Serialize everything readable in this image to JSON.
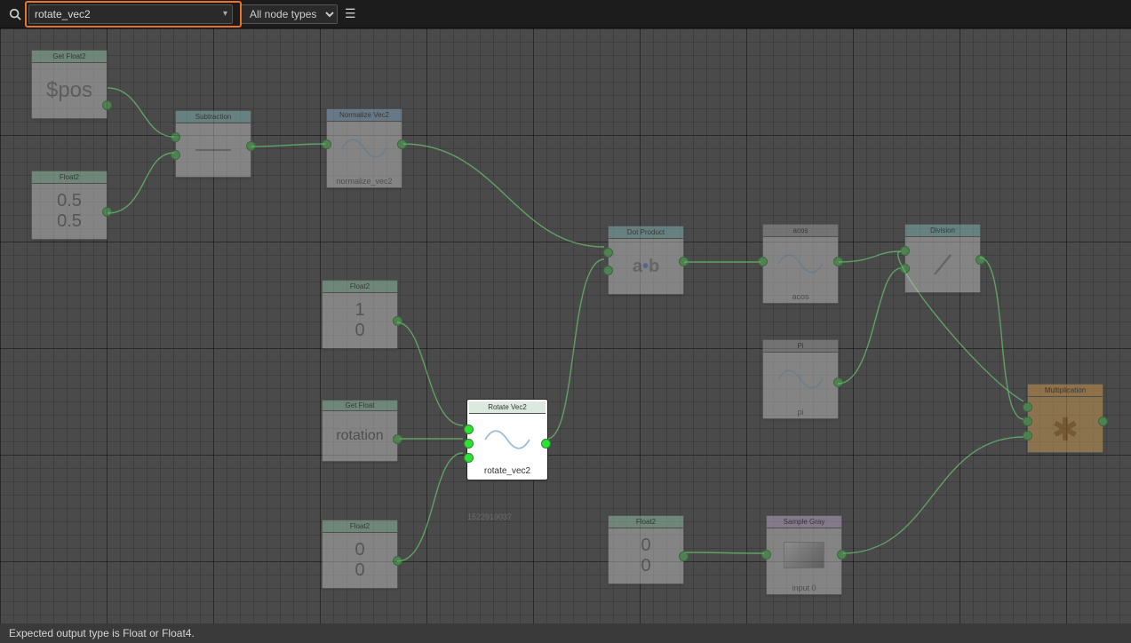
{
  "toolbar": {
    "search_value": "rotate_vec2",
    "filter_label": "All node types"
  },
  "status_text": "Expected output type is Float or Float4.",
  "nodes": {
    "getfloat2": {
      "title": "Get Float2",
      "body": "$pos"
    },
    "float2a": {
      "title": "Float2",
      "v1": "0.5",
      "v2": "0.5"
    },
    "subtraction": {
      "title": "Subtraction"
    },
    "normalize": {
      "title": "Normalize Vec2",
      "foot": "normalize_vec2"
    },
    "float2b": {
      "title": "Float2",
      "v1": "1",
      "v2": "0"
    },
    "getfloat": {
      "title": "Get Float",
      "body": "rotation"
    },
    "float2c": {
      "title": "Float2",
      "v1": "0",
      "v2": "0"
    },
    "rotate": {
      "title": "Rotate Vec2",
      "foot": "rotate_vec2",
      "id": "1522919037"
    },
    "dot": {
      "title": "Dot Product"
    },
    "float2d": {
      "title": "Float2",
      "v1": "0",
      "v2": "0"
    },
    "acos": {
      "title": "acos",
      "foot": "acos"
    },
    "pi": {
      "title": "Pi",
      "foot": "pi"
    },
    "sample": {
      "title": "Sample Gray",
      "foot": "input 0"
    },
    "division": {
      "title": "Division"
    },
    "mult": {
      "title": "Multiplication"
    }
  }
}
